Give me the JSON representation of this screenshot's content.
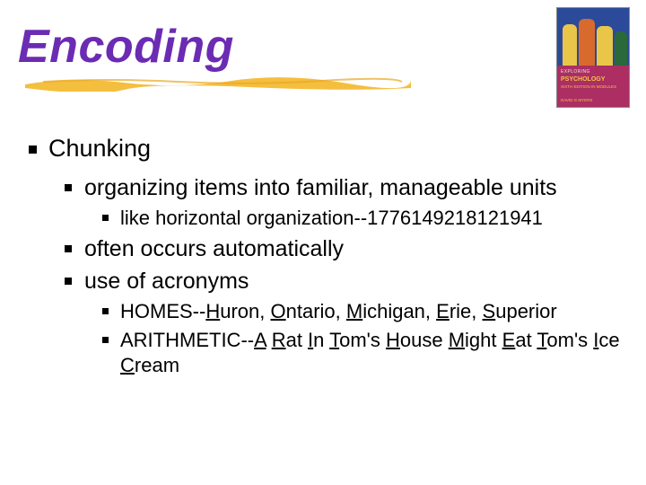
{
  "title": "Encoding",
  "book": {
    "line1": "EXPLORING",
    "line2": "PSYCHOLOGY",
    "line3": "SIXTH EDITION IN MODULES",
    "author": "DAVID G MYERS"
  },
  "bullets": {
    "l1": "Chunking",
    "l2a": "organizing items into familiar, manageable units",
    "l3a": "like horizontal organization--1776149218121941",
    "l2b": "often occurs automatically",
    "l2c": "use of acronyms",
    "homes": {
      "prefix": "HOMES--",
      "h": "H",
      "h2": "uron, ",
      "o": "O",
      "o2": "ntario, ",
      "m": "M",
      "m2": "ichigan, ",
      "e": "E",
      "e2": "rie, ",
      "s": "S",
      "s2": "uperior"
    },
    "arith": {
      "prefix": "ARITHMETIC--",
      "a": "A",
      "a2": " ",
      "r": "R",
      "r2": "at ",
      "i": "I",
      "i2": "n ",
      "t": "T",
      "t2": "om's ",
      "h": "H",
      "h2": "ouse ",
      "m": "M",
      "m2": "ight ",
      "e": "E",
      "e2": "at ",
      "t3": "T",
      "t4": "om's ",
      "i3": "I",
      "i4": "ce ",
      "c": "C",
      "c2": "ream"
    }
  }
}
